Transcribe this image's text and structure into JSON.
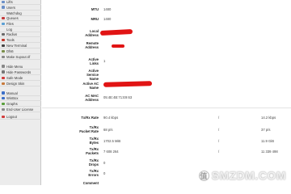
{
  "sidebar": {
    "items": [
      {
        "label": "Lifts",
        "icon": "list-icon",
        "color": "#6b8fc7"
      },
      {
        "label": "Users",
        "icon": "users-icon",
        "color": "#6b8fc7"
      },
      {
        "label": "Watchdog",
        "icon": "",
        "color": ""
      },
      {
        "label": "Queues",
        "icon": "queue-icon",
        "color": "#c43c3c"
      },
      {
        "label": "Files",
        "icon": "files-icon",
        "color": "#5a9fd4"
      },
      {
        "label": "Log",
        "icon": "",
        "color": ""
      },
      {
        "label": "Radius",
        "icon": "radius-icon",
        "color": "#6a6a6a"
      },
      {
        "label": "Tools",
        "icon": "tools-icon",
        "color": "#c0392b"
      },
      {
        "label": "New Terminal",
        "icon": "terminal-icon",
        "color": "#444444"
      },
      {
        "label": "Dfs6",
        "icon": "dfs-icon",
        "color": "#7a8f4a"
      },
      {
        "label": "Make Supout.rif",
        "icon": "supout-icon",
        "color": "#888888"
      },
      {
        "label": "Hide Menu",
        "icon": "menu-icon",
        "color": "#888888"
      },
      {
        "label": "Hide Passwords",
        "icon": "lock-icon",
        "color": "#777777"
      },
      {
        "label": "Safe Mode",
        "icon": "safe-mode-icon",
        "color": "#d23c3c"
      },
      {
        "label": "Design Skin",
        "icon": "skin-icon",
        "color": "#c87a3c"
      },
      {
        "label": "Manual",
        "icon": "manual-icon",
        "color": "#3c6fc8"
      },
      {
        "label": "WinBox",
        "icon": "winbox-icon",
        "color": "#3c6fc8"
      },
      {
        "label": "Graphs",
        "icon": "graphs-icon",
        "color": "#5aa03c"
      },
      {
        "label": "End-User License",
        "icon": "license-icon",
        "color": "#888888"
      },
      {
        "label": "Logout",
        "icon": "logout-icon",
        "color": "#d23c3c"
      }
    ]
  },
  "details": {
    "mtu_label": "MTU",
    "mtu_value": "1480",
    "mru_label": "MRU",
    "mru_value": "1480",
    "local_address_label": "Local\nAddress",
    "remote_address_label": "Remote\nAddress",
    "active_links_label": "Active\nLinks",
    "active_links_value": "1",
    "active_service_label": "Active\nService\nName",
    "active_ac_name_label": "Active AC\nName",
    "ac_mac_label": "AC MAC\nAddress",
    "ac_mac_value": "05:4E:4B:71:E9:63",
    "tx_rx_rate_label": "Tx/Rx Rate",
    "tx_rate": "90.4 kbps",
    "rx_rate": "14.2 kbps",
    "tx_rx_packet_rate_label": "Tx/Rx\nPacket Rate",
    "tx_packet_rate": "68 p/s",
    "rx_packet_rate": "37 p/s",
    "tx_rx_bytes_label": "Tx/Rx\nBytes",
    "tx_bytes": "1702.5 MiB",
    "rx_bytes": "11.9 GiB",
    "tx_rx_packets_label": "Tx/Rx\nPackets",
    "tx_packets": "7 608 264",
    "rx_packets": "11 339 498",
    "tx_rx_drops_label": "Tx/Rx\nDrops",
    "tx_drops": "0",
    "tx_rx_errors_label": "Tx/Rx\nErrors",
    "tx_errors": "0",
    "comment_label": "Comment",
    "slash": "/"
  },
  "watermark": {
    "text": "SMZDM.COM",
    "badge": "值"
  },
  "colors": {
    "redaction": "#e11414",
    "sidebar_bg": "#ececec"
  }
}
